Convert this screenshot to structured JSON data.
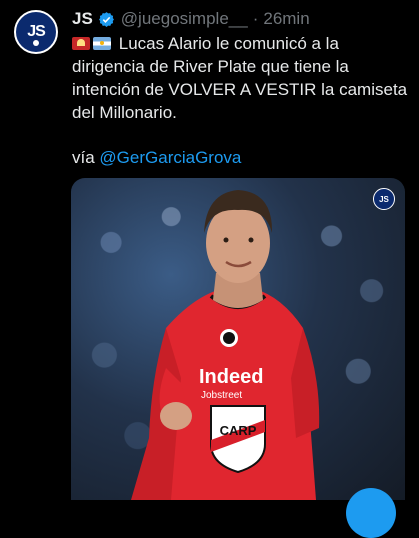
{
  "tweet": {
    "name": "JS",
    "handle": "@juegosimple__",
    "separator": "·",
    "time": "26min",
    "text": "Lucas Alario le comunicó a la dirigencia de River Plate que tiene la intención de VOLVER A VESTIR la camiseta del Millonario.",
    "via_label": "vía",
    "via_mention": "@GerGarciaGrova",
    "avatar_text": "JS",
    "watermark_text": "JS",
    "icons": [
      "verified-badge-icon",
      "siren-emoji-icon",
      "argentina-flag-icon"
    ],
    "colors": {
      "accent": "#1d9bf0",
      "muted": "#71767b",
      "background": "#000000",
      "shirt": "#e0262f"
    }
  },
  "media": {
    "crest_text": "CARP",
    "shirt_text_1": "Indeed",
    "shirt_text_2": "Jobstreet"
  }
}
